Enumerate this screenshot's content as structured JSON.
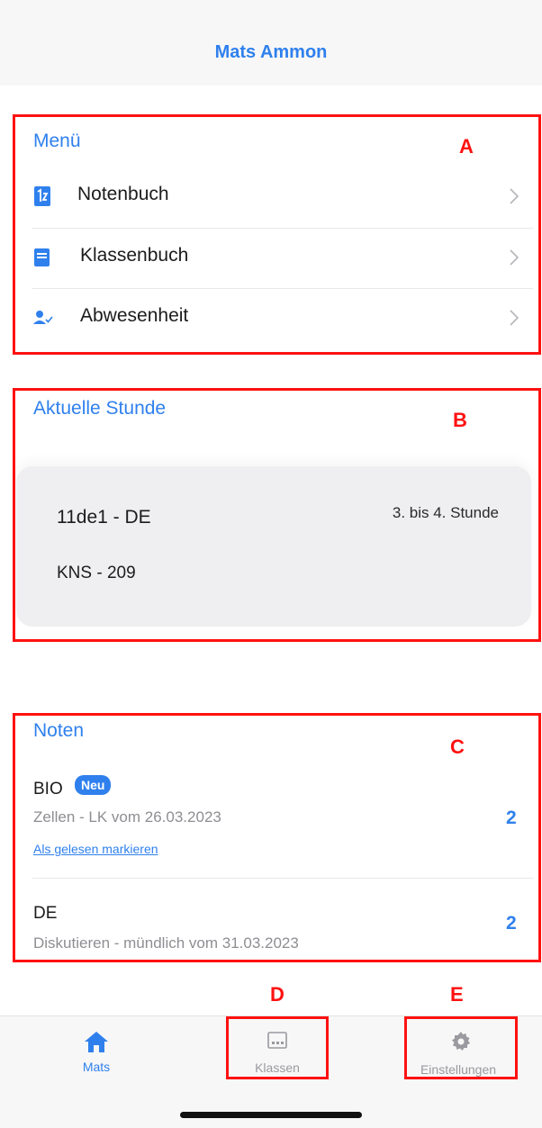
{
  "header": {
    "title": "Mats Ammon"
  },
  "annotations": {
    "a": "A",
    "b": "B",
    "c": "C",
    "d": "D",
    "e": "E"
  },
  "menu": {
    "title": "Menü",
    "items": [
      {
        "label": "Notenbuch",
        "icon": "gradebook-icon"
      },
      {
        "label": "Klassenbuch",
        "icon": "book-icon"
      },
      {
        "label": "Abwesenheit",
        "icon": "person-check-icon"
      }
    ]
  },
  "current_lesson": {
    "title": "Aktuelle Stunde",
    "class_subject": "11de1 - DE",
    "period": "3. bis 4. Stunde",
    "room": "KNS - 209"
  },
  "grades": {
    "title": "Noten",
    "items": [
      {
        "subject": "BIO",
        "badge": "Neu",
        "description": "Zellen - LK vom 26.03.2023",
        "grade": "2",
        "mark_read": "Als gelesen markieren"
      },
      {
        "subject": "DE",
        "description": "Diskutieren - mündlich vom 31.03.2023",
        "grade": "2"
      }
    ]
  },
  "tabbar": {
    "tabs": [
      {
        "label": "Mats",
        "icon": "home-icon",
        "active": true
      },
      {
        "label": "Klassen",
        "icon": "classroom-icon",
        "active": false
      },
      {
        "label": "Einstellungen",
        "icon": "gear-icon",
        "active": false
      }
    ]
  },
  "colors": {
    "accent": "#2f80ed",
    "annotation": "#ff1111",
    "inactive": "#9a9aa0"
  }
}
